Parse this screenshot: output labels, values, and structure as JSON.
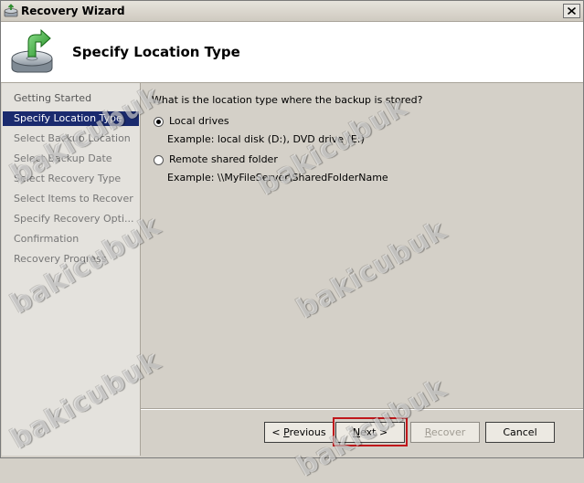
{
  "window": {
    "title": "Recovery Wizard"
  },
  "header": {
    "title": "Specify Location Type"
  },
  "sidebar": {
    "steps": [
      {
        "label": "Getting Started"
      },
      {
        "label": "Specify Location Type"
      },
      {
        "label": "Select Backup Location"
      },
      {
        "label": "Select Backup Date"
      },
      {
        "label": "Select Recovery Type"
      },
      {
        "label": "Select Items to Recover"
      },
      {
        "label": "Specify Recovery Opti..."
      },
      {
        "label": "Confirmation"
      },
      {
        "label": "Recovery Progress"
      }
    ],
    "active_index": 1
  },
  "content": {
    "question": "What is the location type where the backup is stored?",
    "options": [
      {
        "label": "Local drives",
        "example": "Example: local disk (D:), DVD drive (E:)",
        "selected": true
      },
      {
        "label": "Remote shared folder",
        "example": "Example: \\\\MyFileServer\\SharedFolderName",
        "selected": false
      }
    ]
  },
  "buttons": {
    "previous": {
      "mnemonic": "P",
      "rest": "revious",
      "prefix": "< "
    },
    "next": {
      "mnemonic": "N",
      "rest": "ext >"
    },
    "recover": {
      "mnemonic": "R",
      "rest": "ecover"
    },
    "cancel": {
      "label": "Cancel"
    }
  },
  "watermark": {
    "text": "bakicubuk"
  },
  "colors": {
    "active_step": "#1a2a6e",
    "highlight": "#c0171b"
  }
}
